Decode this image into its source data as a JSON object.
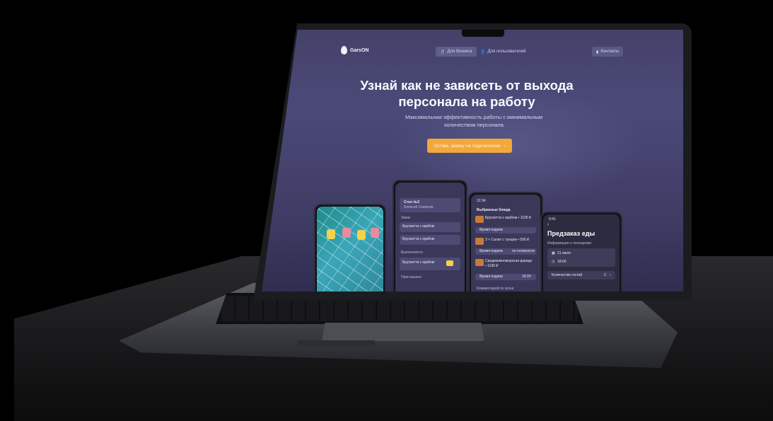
{
  "app": {
    "logo_text": "GarsON"
  },
  "nav": {
    "business_label": "Для бизнеса",
    "users_label": "Для пользователей",
    "contacts_label": "Контакты"
  },
  "hero": {
    "title_line1": "Узнай как не зависеть от выхода",
    "title_line2": "персонала на работу",
    "subtitle_line1": "Максимальная эффективность работы с минимальным",
    "subtitle_line2": "количеством персонала",
    "cta_label": "Оставь заявку на подключение"
  },
  "phone_order": {
    "table_label": "Стол №3",
    "waiter_label": "Алексей Смирнов",
    "order_label": "Заказ",
    "item1": "Брускетта с крабом",
    "item2": "Брускетта с крабом",
    "executing_label": "Выполняется",
    "item3": "Брускетта с крабом",
    "invited_label": "Приглашено"
  },
  "phone_selected": {
    "time": "12:34",
    "header": "Выбранные блюда",
    "item1": "Брускетта с крабом • 1190 ₽",
    "serve_time1": "Время подачи",
    "item2": "3 × Салат с тунцом • 590 ₽",
    "serve_time2": "Время подачи",
    "serve_value2": "по готовности",
    "item3_line1": "Средиземноморская дорадо",
    "item3_line2": "• 1190 ₽",
    "serve_time3": "Время подачи",
    "serve_value3": "18:20",
    "comment_label": "Комментарий по кухне"
  },
  "phone_preorder": {
    "time": "9:41",
    "title": "Предзаказ еды",
    "section_label": "Информация о посещении",
    "date": "21 июля",
    "hour": "18:00",
    "guests_label": "Количество гостей",
    "guests_value": "2"
  },
  "colors": {
    "screen_bg": "#44426a",
    "cta": "#f2a83a",
    "text": "#fafaff"
  }
}
